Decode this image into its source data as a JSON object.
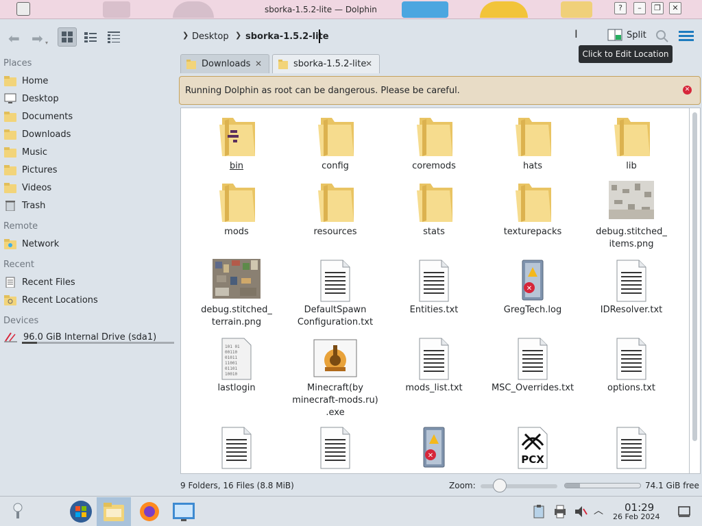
{
  "window": {
    "title": "sborka-1.5.2-lite — Dolphin"
  },
  "toolbar": {
    "breadcrumb": [
      "Desktop",
      "sborka-1.5.2-lite"
    ],
    "split_label": "Split",
    "tooltip": "Click to Edit Location"
  },
  "sidebar": {
    "sections": {
      "places": "Places",
      "remote": "Remote",
      "recent": "Recent",
      "devices": "Devices"
    },
    "places": [
      "Home",
      "Desktop",
      "Documents",
      "Downloads",
      "Music",
      "Pictures",
      "Videos",
      "Trash"
    ],
    "remote": [
      "Network"
    ],
    "recent": [
      "Recent Files",
      "Recent Locations"
    ],
    "devices": [
      {
        "label": "96.0 GiB Internal Drive (sda1)",
        "usage_fraction": 0.1
      }
    ]
  },
  "tabs": [
    {
      "label": "Downloads",
      "active": false
    },
    {
      "label": "sborka-1.5.2-lite",
      "active": true
    }
  ],
  "warning": {
    "text": "Running Dolphin as root can be dangerous. Please be careful."
  },
  "files": [
    {
      "name": "bin",
      "type": "folder-bin"
    },
    {
      "name": "config",
      "type": "folder"
    },
    {
      "name": "coremods",
      "type": "folder"
    },
    {
      "name": "hats",
      "type": "folder"
    },
    {
      "name": "lib",
      "type": "folder"
    },
    {
      "name": "mods",
      "type": "folder"
    },
    {
      "name": "resources",
      "type": "folder"
    },
    {
      "name": "stats",
      "type": "folder"
    },
    {
      "name": "texturepacks",
      "type": "folder"
    },
    {
      "name": "debug.stitched_\nitems.png",
      "type": "image"
    },
    {
      "name": "debug.stitched_\nterrain.png",
      "type": "image2"
    },
    {
      "name": "DefaultSpawn\nConfiguration.txt",
      "type": "text"
    },
    {
      "name": "Entities.txt",
      "type": "text"
    },
    {
      "name": "GregTech.log",
      "type": "log"
    },
    {
      "name": "IDResolver.txt",
      "type": "text"
    },
    {
      "name": "lastlogin",
      "type": "binary"
    },
    {
      "name": "Minecraft(by\nminecraft-mods.ru)\n.exe",
      "type": "exe"
    },
    {
      "name": "mods_list.txt",
      "type": "text"
    },
    {
      "name": "MSC_Overrides.txt",
      "type": "text"
    },
    {
      "name": "options.txt",
      "type": "text"
    },
    {
      "name": "",
      "type": "text"
    },
    {
      "name": "",
      "type": "text"
    },
    {
      "name": "",
      "type": "log"
    },
    {
      "name": "",
      "type": "pcx"
    },
    {
      "name": "",
      "type": "text"
    }
  ],
  "status": {
    "summary": "9 Folders, 16 Files (8.8 MiB)",
    "zoom_label": "Zoom:",
    "zoom_fraction": 0.25,
    "free_space": "74.1 GiB free",
    "used_fraction": 0.2
  },
  "taskbar": {
    "time": "01:29",
    "date": "26 Feb 2024"
  },
  "colors": {
    "accent": "#3daee9",
    "folder": "#f2d47a",
    "warning_border": "#c4a25e",
    "close_red": "#d6263a"
  }
}
